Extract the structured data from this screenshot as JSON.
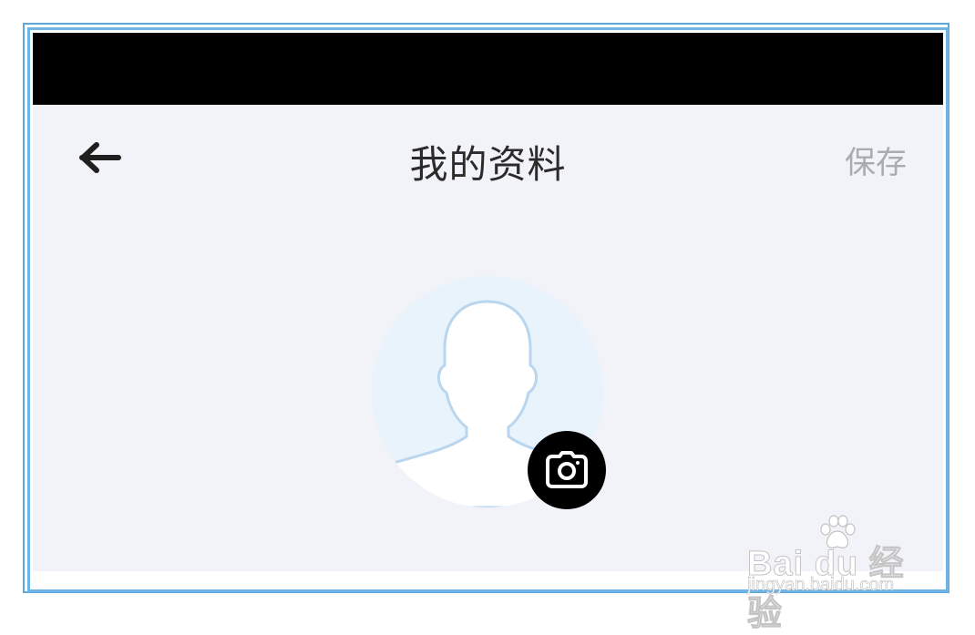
{
  "nav": {
    "back_icon": "back-arrow-icon",
    "title": "我的资料",
    "save_label": "保存"
  },
  "avatar": {
    "icon": "default-person-avatar",
    "camera_icon": "camera-icon"
  },
  "watermark": {
    "brand": "Bai du 经验",
    "url": "jingyan.baidu.com"
  },
  "colors": {
    "frame": "#5aa8de",
    "status_bar": "#000000",
    "background": "#f2f3f8",
    "avatar_bg": "#e8f3fb",
    "title": "#2b2b2b",
    "save_disabled": "#a9abb3"
  }
}
